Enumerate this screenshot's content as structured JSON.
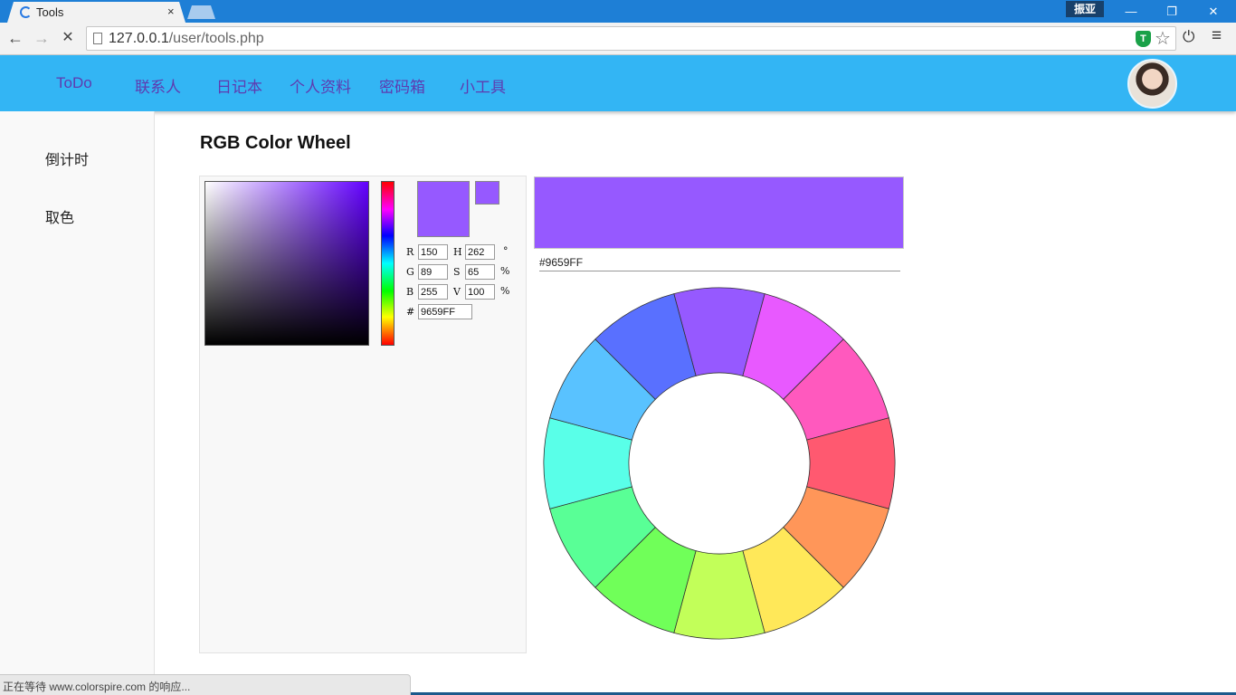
{
  "browser": {
    "tab_title": "Tools",
    "tab_close": "×",
    "profile_name": "振亚",
    "url_host": "127.0.0.1",
    "url_path": "/user/tools.php",
    "status_text": "正在等待 www.colorspire.com 的响应..."
  },
  "nav": {
    "items": [
      "ToDo",
      "联系人",
      "日记本",
      "个人资料",
      "密码箱",
      "小工具"
    ]
  },
  "sidebar": {
    "items": [
      "倒计时",
      "取色"
    ]
  },
  "page": {
    "title": "RGB Color Wheel"
  },
  "picker": {
    "r_label": "R",
    "r_value": "150",
    "g_label": "G",
    "g_value": "89",
    "b_label": "B",
    "b_value": "255",
    "h_label": "H",
    "h_value": "262",
    "h_unit": "°",
    "s_label": "S",
    "s_value": "65",
    "s_unit": "%",
    "v_label": "V",
    "v_value": "100",
    "v_unit": "%",
    "hash_label": "#",
    "hex_value": "9659FF",
    "current_color": "#9659FF",
    "hue_color": "#6200FF"
  },
  "preview": {
    "hex_text": "#9659FF"
  },
  "wheel": {
    "segments": [
      "#9659FF",
      "#E859FF",
      "#FF59BE",
      "#FF5970",
      "#FF9659",
      "#FFE859",
      "#C2FF59",
      "#70FF59",
      "#59FF96",
      "#59FFE8",
      "#59C2FF",
      "#5970FF"
    ]
  },
  "icons": {
    "back": "←",
    "forward": "→",
    "stop": "✕",
    "star": "☆",
    "power": "⏻",
    "menu": "≡",
    "ext": "T",
    "minimize": "—",
    "restore": "❐",
    "close": "✕"
  }
}
